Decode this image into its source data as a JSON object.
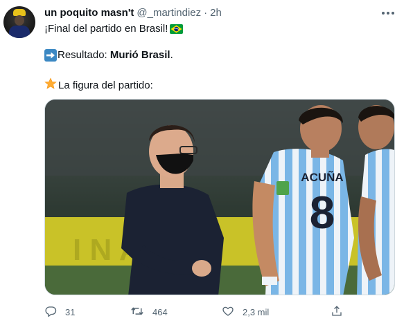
{
  "tweet": {
    "author_name": "un poquito masn't",
    "handle": "@_martindiez",
    "separator": "·",
    "time": "2h",
    "line1": "¡Final del partido en Brasil!",
    "line2_prefix": "Resultado: ",
    "line2_bold": "Murió Brasil",
    "line2_suffix": ".",
    "line3": "La figura del partido:",
    "icons": [
      "more-icon",
      "brazil-flag-icon",
      "arrow-right-icon",
      "star-icon",
      "reply-icon",
      "retweet-icon",
      "like-icon",
      "share-icon"
    ]
  },
  "photo": {
    "jersey_name": "ACUÑA",
    "jersey_number": "8",
    "colors": {
      "jersey_blue": "#7ab6e6",
      "shirt_dark": "#1b2233",
      "field_green": "#4a6a3a",
      "banner_yellow": "#d8cf2a"
    }
  },
  "actions": {
    "replies": "31",
    "retweets": "464",
    "likes": "2,3 mil"
  },
  "colors": {
    "text": "#0f1419",
    "secondary": "#536471",
    "border": "#cfd9de"
  }
}
